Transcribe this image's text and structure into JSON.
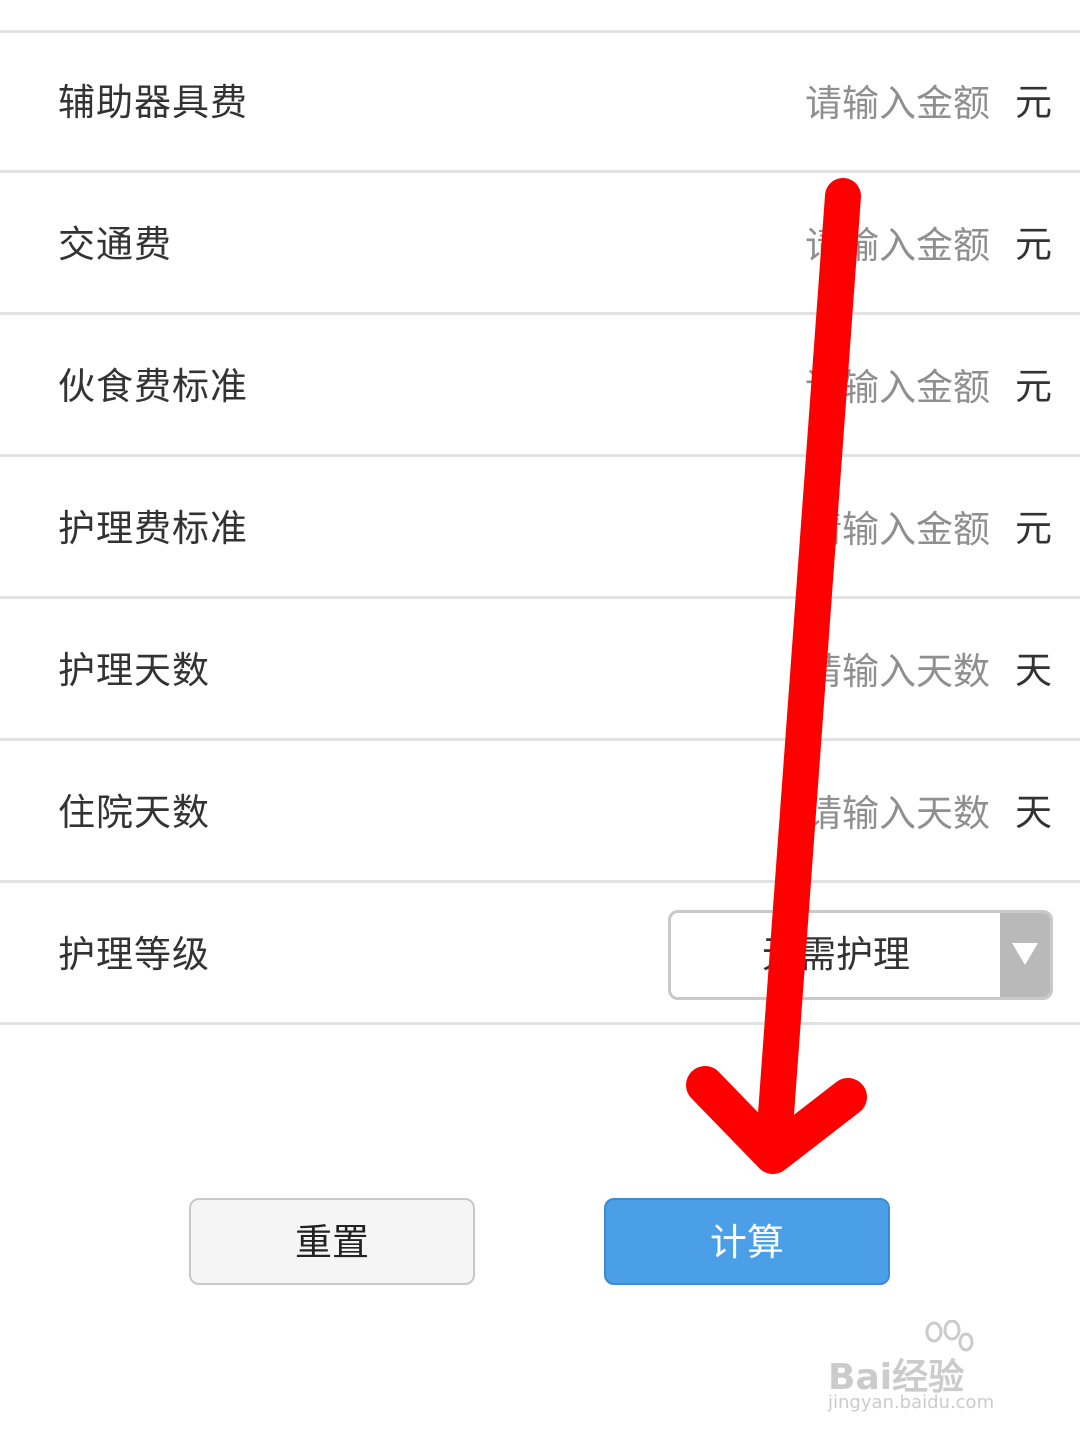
{
  "form": {
    "rows": [
      {
        "label": "辅助器具费",
        "placeholder": "请输入金额",
        "unit": "元"
      },
      {
        "label": "交通费",
        "placeholder": "请输入金额",
        "unit": "元"
      },
      {
        "label": "伙食费标准",
        "placeholder": "请输入金额",
        "unit": "元"
      },
      {
        "label": "护理费标准",
        "placeholder": "请输入金额",
        "unit": "元"
      },
      {
        "label": "护理天数",
        "placeholder": "请输入天数",
        "unit": "天"
      },
      {
        "label": "住院天数",
        "placeholder": "请输入天数",
        "unit": "天"
      }
    ],
    "care_level": {
      "label": "护理等级",
      "selected": "无需护理"
    }
  },
  "actions": {
    "reset_label": "重置",
    "calculate_label": "计算"
  },
  "annotation": {
    "arrow_color": "#ff0000"
  },
  "watermark": {
    "logo": "Bai经验",
    "url": "jingyan.baidu.com"
  },
  "colors": {
    "primary_button": "#4a9fe7",
    "divider": "#e2e2e2",
    "placeholder": "#8f8f8f"
  }
}
